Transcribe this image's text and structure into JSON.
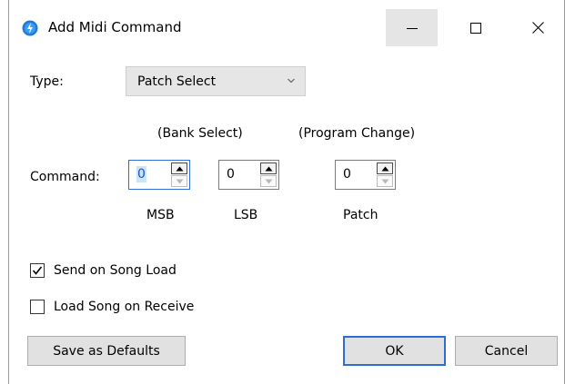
{
  "window": {
    "title": "Add Midi Command",
    "minimize_glyph": "—",
    "maximize_glyph": "☐",
    "close_glyph": "✕"
  },
  "type": {
    "label": "Type:",
    "selected": "Patch Select"
  },
  "columns": {
    "bank_select": "(Bank Select)",
    "program_change": "(Program Change)"
  },
  "command": {
    "label": "Command:",
    "msb": {
      "value": "0",
      "caption": "MSB"
    },
    "lsb": {
      "value": "0",
      "caption": "LSB"
    },
    "patch": {
      "value": "0",
      "caption": "Patch"
    }
  },
  "options": {
    "send_on_song_load": {
      "label": "Send on Song Load",
      "checked": true
    },
    "load_song_on_receive": {
      "label": "Load Song on Receive",
      "checked": false
    }
  },
  "buttons": {
    "save_defaults": "Save as Defaults",
    "ok": "OK",
    "cancel": "Cancel"
  },
  "colors": {
    "accent": "#2b6fd6",
    "app_icon": "#1f7ad6"
  },
  "icons": {
    "app": "midi-app-icon",
    "chevron": "chevron-down-icon",
    "spin_up": "arrow-up-icon",
    "spin_down": "arrow-down-icon",
    "check": "checkmark-icon"
  }
}
